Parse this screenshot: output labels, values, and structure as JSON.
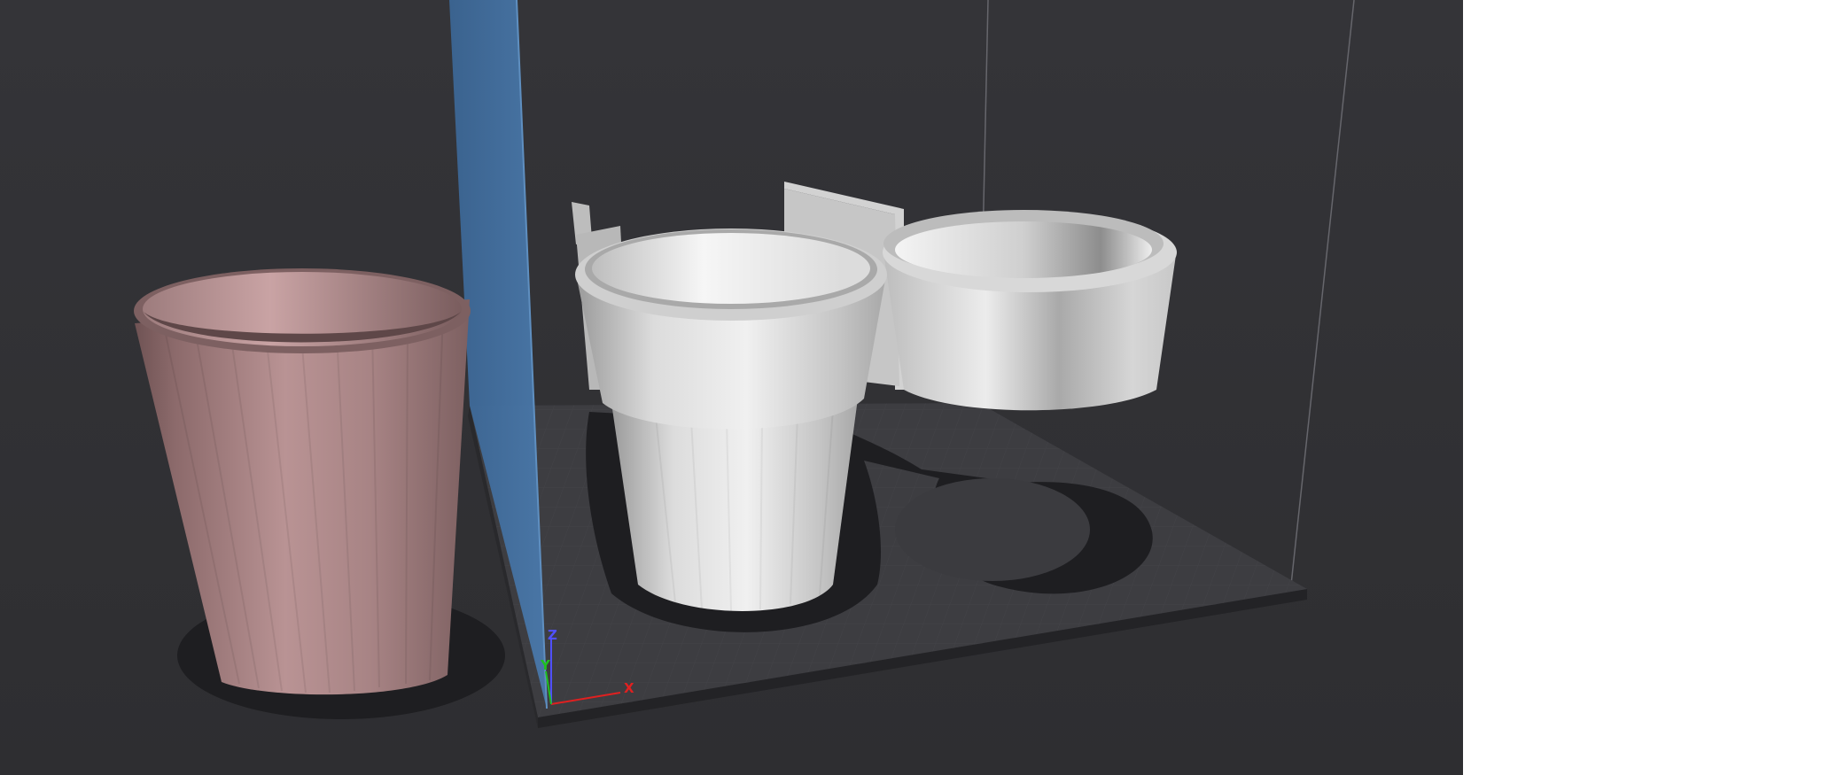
{
  "viewport": {
    "background_color": "#323235",
    "bed_color": "#3e3e42",
    "bed_edge_color": "#2a2a2d",
    "grid_color": "#47474c",
    "volume_wall_color": "#3d6a98",
    "build_volume_line_color": "#6a6a70"
  },
  "objects": {
    "outside_cup": {
      "color": "#b08b8b",
      "state": "outside build volume"
    },
    "holder_cup_left": {
      "color": "#d6d6d6"
    },
    "holder_cup_right": {
      "color": "#d6d6d6"
    }
  },
  "axis_gizmo": {
    "x": "X",
    "y": "Y",
    "z": "Z",
    "x_color": "#e02020",
    "y_color": "#20c020",
    "z_color": "#5050ff"
  }
}
